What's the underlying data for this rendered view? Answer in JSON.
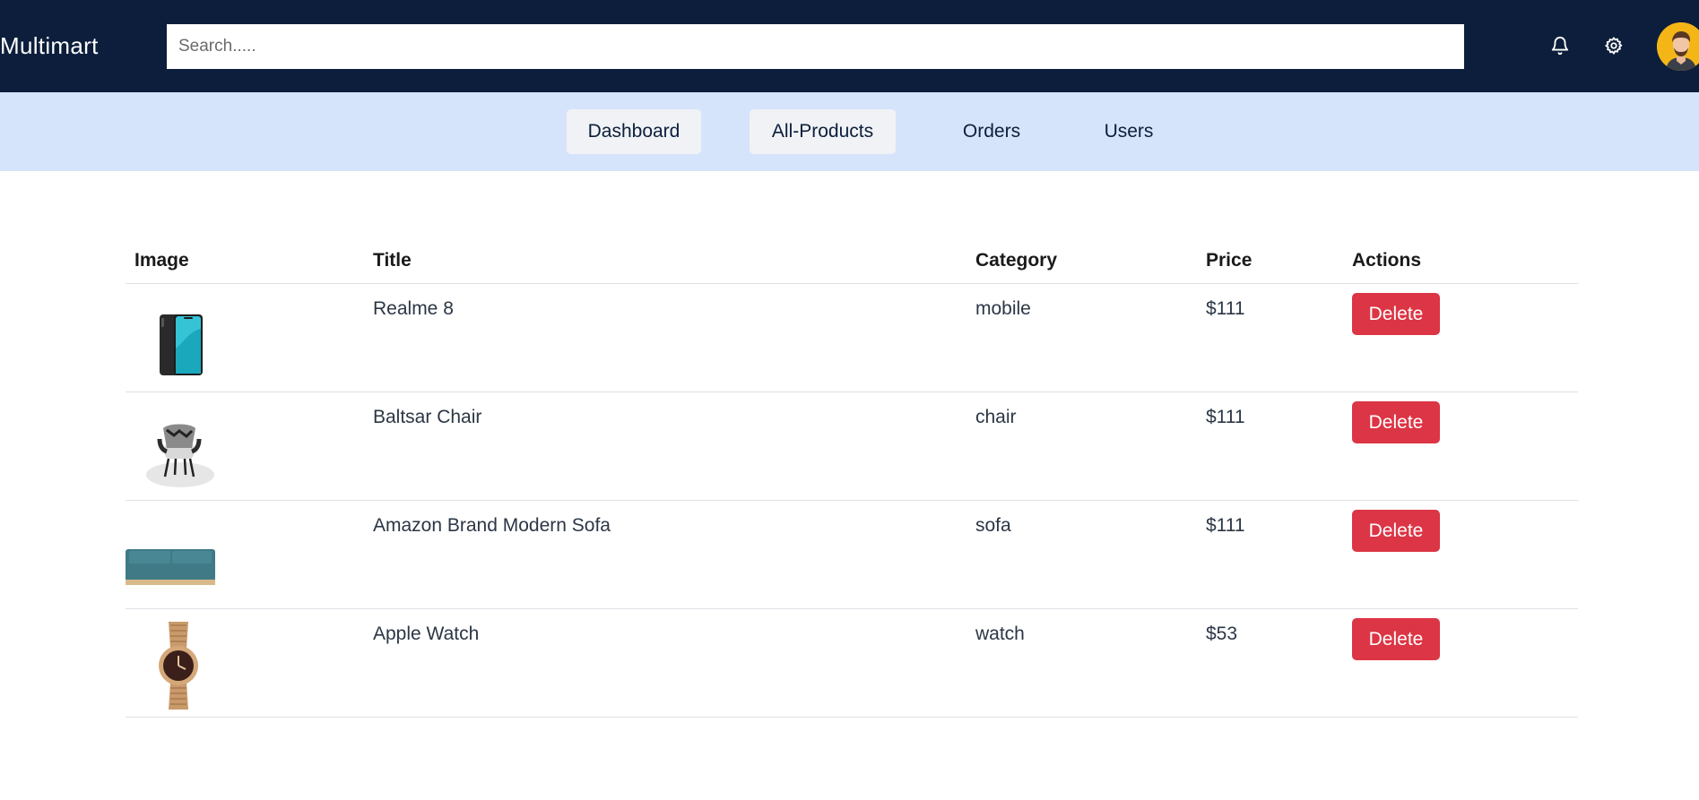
{
  "header": {
    "brand": "Multimart",
    "search_placeholder": "Search.....",
    "icons": [
      "bell-icon",
      "gear-icon"
    ],
    "colors": {
      "background": "#0c1e3b",
      "text": "#ffffff"
    }
  },
  "nav": {
    "items": [
      {
        "label": "Dashboard"
      },
      {
        "label": "All-Products"
      },
      {
        "label": "Orders"
      },
      {
        "label": "Users"
      }
    ],
    "colors": {
      "background": "#d6e4fb",
      "active_pill": "#f0f2f5"
    }
  },
  "table": {
    "columns": [
      "Image",
      "Title",
      "Category",
      "Price",
      "Actions"
    ],
    "rows": [
      {
        "image": "phone-image",
        "title": "Realme 8",
        "category": "mobile",
        "price": "$111",
        "action": "Delete"
      },
      {
        "image": "chair-image",
        "title": "Baltsar Chair",
        "category": "chair",
        "price": "$111",
        "action": "Delete"
      },
      {
        "image": "sofa-image",
        "title": "Amazon Brand Modern Sofa",
        "category": "sofa",
        "price": "$111",
        "action": "Delete"
      },
      {
        "image": "watch-image",
        "title": "Apple Watch",
        "category": "watch",
        "price": "$53",
        "action": "Delete"
      }
    ],
    "colors": {
      "delete_button": "#dc3545"
    }
  }
}
